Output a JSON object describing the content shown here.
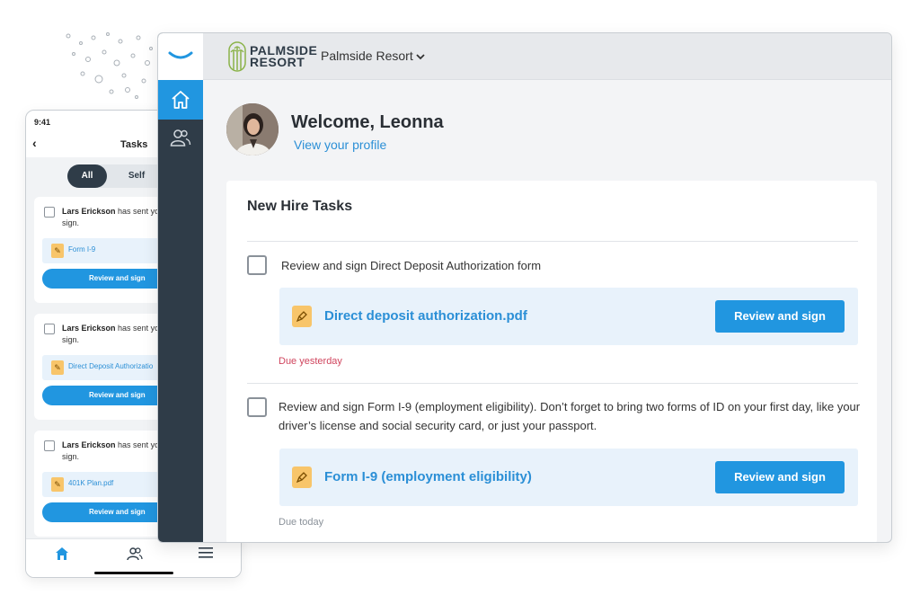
{
  "phone": {
    "time": "9:41",
    "back_glyph": "‹",
    "title": "Tasks",
    "filters": [
      "All",
      "Self"
    ],
    "tasks": [
      {
        "sender": "Lars Erickson",
        "message": "has sent you",
        "message2": "sign.",
        "file": "Form I-9",
        "button": "Review and sign"
      },
      {
        "sender": "Lars Erickson",
        "message": "has sent you",
        "message2": "sign.",
        "file": "Direct Deposit Authorizatio",
        "button": "Review and sign"
      },
      {
        "sender": "Lars Erickson",
        "message": "has sent you",
        "message2": "sign.",
        "file": "401K Plan.pdf",
        "button": "Review and sign"
      }
    ],
    "tabbar": {
      "home_icon": "home-icon",
      "people_icon": "people-icon",
      "menu_icon": "menu-icon"
    }
  },
  "desktop": {
    "brand": {
      "line1": "PALMSIDE",
      "line2": "RESORT"
    },
    "org": "Palmside Resort",
    "welcome": "Welcome, Leonna",
    "profile_link": "View your profile",
    "panel_title": "New Hire Tasks",
    "tasks": [
      {
        "text": "Review and sign Direct Deposit Authorization form",
        "file": "Direct deposit authorization.pdf",
        "button": "Review and sign",
        "due": "Due yesterday",
        "due_color": "#d0455e"
      },
      {
        "text": "Review and sign Form I-9 (employment eligibility). Don’t forget to bring two forms of ID on your first day, like your driver’s license and social security card, or just your passport.",
        "file": "Form I-9 (employment eligibility)",
        "button": "Review and sign",
        "due": "Due today",
        "due_color": "#8a9199"
      }
    ]
  },
  "colors": {
    "accent": "#2196e0",
    "rail": "#2f3c48",
    "link": "#2b8fd6",
    "overdue": "#d0455e",
    "file_icon": "#f8c56a"
  }
}
